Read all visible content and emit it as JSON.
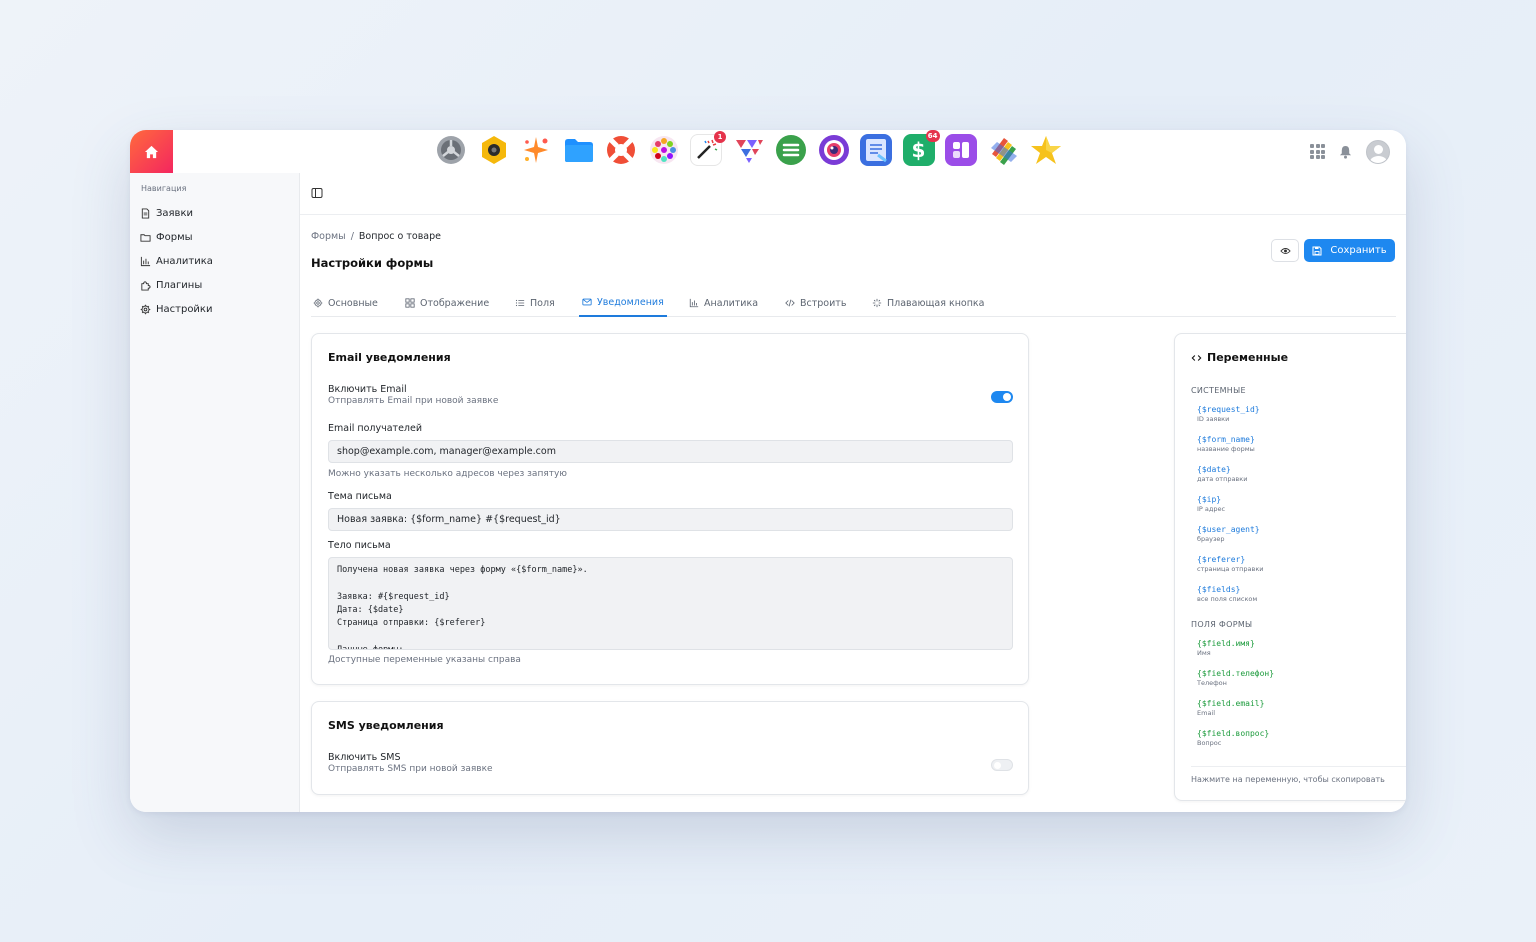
{
  "sidebar": {
    "title": "Навигация",
    "items": [
      {
        "label": "Заявки",
        "icon": "document-icon"
      },
      {
        "label": "Формы",
        "icon": "folder-icon"
      },
      {
        "label": "Аналитика",
        "icon": "bar-chart-icon"
      },
      {
        "label": "Плагины",
        "icon": "puzzle-icon"
      },
      {
        "label": "Настройки",
        "icon": "gear-icon"
      }
    ]
  },
  "dock": {
    "apps": [
      {
        "name": "settings-app-icon",
        "color": "#8f949b"
      },
      {
        "name": "camera-app-icon",
        "color": "#f5b80b"
      },
      {
        "name": "sparkle-app-icon",
        "color": "#ff8a2b"
      },
      {
        "name": "files-app-icon",
        "color": "#1e90ff"
      },
      {
        "name": "lifebuoy-app-icon",
        "color": "#f04e37"
      },
      {
        "name": "palette-app-icon",
        "color": "#d14fa0"
      },
      {
        "name": "magic-wand-app-icon",
        "color": "#333333",
        "badge": "1"
      },
      {
        "name": "triangles-app-icon",
        "color": "#e0455a"
      },
      {
        "name": "list-app-icon",
        "color": "#3aa14b"
      },
      {
        "name": "lens-app-icon",
        "color": "#7a3bd6"
      },
      {
        "name": "notes-app-icon",
        "color": "#3b6fe0"
      },
      {
        "name": "money-app-icon",
        "color": "#1fae6a",
        "badge": "64"
      },
      {
        "name": "app-grid-purple-icon",
        "color": "#9b4de8"
      },
      {
        "name": "stripes-app-icon",
        "color": "#e8553b"
      },
      {
        "name": "star-app-icon",
        "color": "#f6c21c"
      }
    ]
  },
  "breadcrumb": {
    "parent": "Формы",
    "separator": "/",
    "current": "Вопрос о товаре"
  },
  "page": {
    "title": "Настройки формы",
    "save_label": "Сохранить"
  },
  "tabs": [
    {
      "label": "Основные",
      "icon": "gear-icon"
    },
    {
      "label": "Отображение",
      "icon": "layout-grid-icon"
    },
    {
      "label": "Поля",
      "icon": "list-icon"
    },
    {
      "label": "Уведомления",
      "icon": "mail-icon",
      "active": true
    },
    {
      "label": "Аналитика",
      "icon": "bar-chart-icon"
    },
    {
      "label": "Встроить",
      "icon": "code-icon"
    },
    {
      "label": "Плавающая кнопка",
      "icon": "sparkle-icon"
    }
  ],
  "email": {
    "title": "Email уведомления",
    "enable_label": "Включить Email",
    "enable_sub": "Отправлять Email при новой заявке",
    "enabled": true,
    "recipients_label": "Email получателей",
    "recipients_value": "shop@example.com, manager@example.com",
    "recipients_hint": "Можно указать несколько адресов через запятую",
    "subject_label": "Тема письма",
    "subject_value": "Новая заявка: {$form_name} #{$request_id}",
    "body_label": "Тело письма",
    "body_value": "Получена новая заявка через форму «{$form_name}».\n\nЗаявка: #{$request_id}\nДата: {$date}\nСтраница отправки: {$referer}\n\nДанные формы:",
    "body_hint": "Доступные переменные указаны справа"
  },
  "sms": {
    "title": "SMS уведомления",
    "enable_label": "Включить SMS",
    "enable_sub": "Отправлять SMS при новой заявке",
    "enabled": false
  },
  "variables": {
    "title": "Переменные",
    "system_title": "СИСТЕМНЫЕ",
    "system": [
      {
        "code": "{$request_id}",
        "desc": "ID заявки"
      },
      {
        "code": "{$form_name}",
        "desc": "название формы"
      },
      {
        "code": "{$date}",
        "desc": "дата отправки"
      },
      {
        "code": "{$ip}",
        "desc": "IP адрес"
      },
      {
        "code": "{$user_agent}",
        "desc": "браузер"
      },
      {
        "code": "{$referer}",
        "desc": "страница отправки"
      },
      {
        "code": "{$fields}",
        "desc": "все поля списком"
      }
    ],
    "fields_title": "ПОЛЯ ФОРМЫ",
    "fields": [
      {
        "code": "{$field.имя}",
        "desc": "Имя"
      },
      {
        "code": "{$field.телефон}",
        "desc": "Телефон"
      },
      {
        "code": "{$field.email}",
        "desc": "Email"
      },
      {
        "code": "{$field.вопрос}",
        "desc": "Вопрос"
      }
    ],
    "footer": "Нажмите на переменную, чтобы скопировать"
  }
}
